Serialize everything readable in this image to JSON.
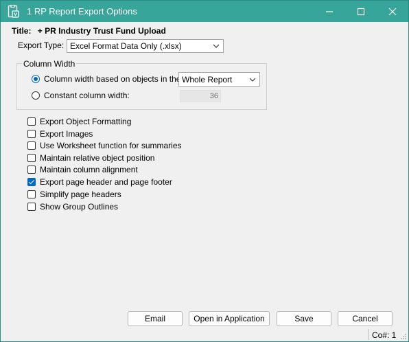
{
  "window": {
    "title": "1 RP Report Export Options",
    "titlebar_color": "#37a59a"
  },
  "report": {
    "title_label": "Title:",
    "title_value": "+ PR Industry Trust Fund Upload"
  },
  "export_type": {
    "label": "Export Type:",
    "value": "Excel Format Data Only (.xlsx)"
  },
  "column_width": {
    "group_label": "Column Width",
    "option_based_label": "Column width based on objects in the:",
    "option_based_selected": true,
    "based_on_value": "Whole Report",
    "option_constant_label": "Constant column width:",
    "option_constant_selected": false,
    "constant_value": "36"
  },
  "options": [
    {
      "label": "Export Object  Formatting",
      "checked": false
    },
    {
      "label": "Export Images",
      "checked": false
    },
    {
      "label": "Use Worksheet function for summaries",
      "checked": false
    },
    {
      "label": "Maintain relative object position",
      "checked": false
    },
    {
      "label": "Maintain column alignment",
      "checked": false
    },
    {
      "label": "Export page header and page footer",
      "checked": true
    },
    {
      "label": "Simplify page headers",
      "checked": false
    },
    {
      "label": "Show Group Outlines",
      "checked": false
    }
  ],
  "buttons": {
    "email": "Email",
    "open": "Open in Application",
    "save": "Save",
    "cancel": "Cancel"
  },
  "status": {
    "company": "Co#: 1"
  },
  "colors": {
    "accent": "#0067c0"
  }
}
